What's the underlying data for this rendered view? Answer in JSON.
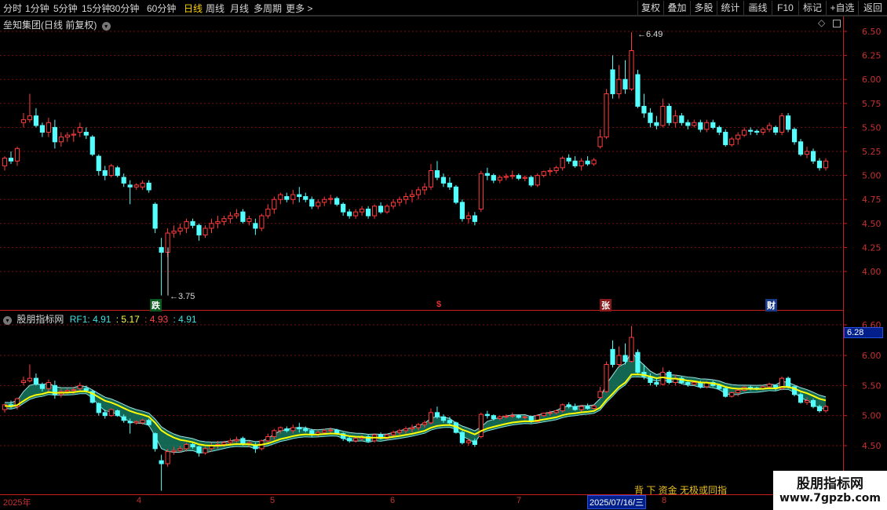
{
  "toolbar": {
    "periods": [
      "分时",
      "1分钟",
      "5分钟",
      "15分钟",
      "30分钟",
      "60分钟",
      "日线",
      "周线",
      "月线",
      "多周期",
      "更多 >"
    ],
    "active_period": "日线",
    "buttons": [
      "复权",
      "叠加",
      "多股",
      "统计",
      "画线",
      "F10",
      "标记",
      "+自选",
      "返回"
    ]
  },
  "main_panel": {
    "title": "垒知集团(日线 前复权)",
    "high_marker": "6.49",
    "low_marker": "3.75",
    "price_axis": [
      "6.50",
      "6.25",
      "6.00",
      "5.75",
      "5.50",
      "5.25",
      "5.00",
      "4.75",
      "4.50",
      "4.25",
      "4.00"
    ],
    "signals": [
      {
        "label": "跌",
        "color": "#ffffff",
        "bg": "#0a5a1e"
      },
      {
        "label": "$",
        "color": "#e03030",
        "bg": ""
      },
      {
        "label": "张",
        "color": "#ffffff",
        "bg": "#8a1a1a"
      },
      {
        "label": "财",
        "color": "#ffffff",
        "bg": "#1a3a8a"
      }
    ]
  },
  "indicator_panel": {
    "name": "股朋指标网",
    "rf1_label": "RF1:",
    "values": [
      "4.91",
      ": 5.17",
      ": 4.93",
      ": 4.91"
    ],
    "value_colors": [
      "#40e0e0",
      "#ffff40",
      "#ff4040",
      "#40e0e0"
    ],
    "axis": [
      "6.60",
      "6.00",
      "5.50",
      "5.00",
      "4.50"
    ],
    "current_box": "6.28",
    "bottom_text": "背 下 资金 无极或同指"
  },
  "time_axis": {
    "labels": [
      "2025年",
      "4",
      "5",
      "6",
      "7",
      "8"
    ],
    "cursor_date": "2025/07/16/三"
  },
  "watermark": {
    "title": "股朋指标网",
    "url": "www.7gpzb.com"
  },
  "colors": {
    "up": "#ff3c3c",
    "down": "#54ffff",
    "grid": "#7a1010",
    "ma": "#ffff00",
    "band_fill": "#1a8a6e"
  },
  "chart_data": {
    "type": "candlestick",
    "ylim": [
      3.7,
      6.6
    ],
    "candles": [
      [
        5.1,
        5.2,
        5.05,
        5.18
      ],
      [
        5.18,
        5.25,
        5.12,
        5.15
      ],
      [
        5.15,
        5.3,
        5.1,
        5.28
      ],
      [
        5.55,
        5.65,
        5.5,
        5.58
      ],
      [
        5.58,
        5.85,
        5.55,
        5.62
      ],
      [
        5.62,
        5.7,
        5.5,
        5.52
      ],
      [
        5.52,
        5.55,
        5.4,
        5.45
      ],
      [
        5.45,
        5.6,
        5.4,
        5.55
      ],
      [
        5.5,
        5.58,
        5.28,
        5.35
      ],
      [
        5.35,
        5.45,
        5.3,
        5.4
      ],
      [
        5.4,
        5.45,
        5.35,
        5.42
      ],
      [
        5.42,
        5.48,
        5.35,
        5.43
      ],
      [
        5.45,
        5.55,
        5.4,
        5.5
      ],
      [
        5.45,
        5.5,
        5.38,
        5.42
      ],
      [
        5.4,
        5.42,
        5.2,
        5.22
      ],
      [
        5.2,
        5.22,
        5.0,
        5.05
      ],
      [
        5.05,
        5.1,
        4.95,
        5.0
      ],
      [
        5.0,
        5.12,
        4.98,
        5.1
      ],
      [
        5.08,
        5.1,
        4.98,
        5.0
      ],
      [
        4.98,
        5.02,
        4.88,
        4.92
      ],
      [
        4.9,
        4.95,
        4.7,
        4.88
      ],
      [
        4.88,
        4.92,
        4.85,
        4.9
      ],
      [
        4.88,
        4.95,
        4.85,
        4.92
      ],
      [
        4.92,
        4.95,
        4.82,
        4.85
      ],
      [
        4.7,
        4.72,
        4.4,
        4.45
      ],
      [
        4.25,
        4.35,
        3.75,
        4.2
      ],
      [
        4.2,
        4.45,
        4.15,
        4.4
      ],
      [
        4.4,
        4.48,
        4.35,
        4.42
      ],
      [
        4.42,
        4.5,
        4.38,
        4.45
      ],
      [
        4.45,
        4.55,
        4.4,
        4.52
      ],
      [
        4.52,
        4.55,
        4.45,
        4.48
      ],
      [
        4.48,
        4.5,
        4.32,
        4.38
      ],
      [
        4.38,
        4.48,
        4.35,
        4.45
      ],
      [
        4.45,
        4.55,
        4.4,
        4.5
      ],
      [
        4.5,
        4.58,
        4.45,
        4.52
      ],
      [
        4.52,
        4.58,
        4.48,
        4.55
      ],
      [
        4.55,
        4.62,
        4.5,
        4.58
      ],
      [
        4.58,
        4.65,
        4.55,
        4.6
      ],
      [
        4.62,
        4.65,
        4.5,
        4.52
      ],
      [
        4.52,
        4.58,
        4.48,
        4.55
      ],
      [
        4.5,
        4.55,
        4.38,
        4.45
      ],
      [
        4.45,
        4.6,
        4.42,
        4.58
      ],
      [
        4.58,
        4.7,
        4.55,
        4.65
      ],
      [
        4.65,
        4.78,
        4.6,
        4.75
      ],
      [
        4.75,
        4.82,
        4.7,
        4.8
      ],
      [
        4.78,
        4.82,
        4.72,
        4.75
      ],
      [
        4.75,
        4.85,
        4.7,
        4.8
      ],
      [
        4.8,
        4.88,
        4.72,
        4.78
      ],
      [
        4.78,
        4.82,
        4.72,
        4.75
      ],
      [
        4.75,
        4.78,
        4.65,
        4.68
      ],
      [
        4.68,
        4.75,
        4.65,
        4.72
      ],
      [
        4.72,
        4.78,
        4.68,
        4.75
      ],
      [
        4.75,
        4.8,
        4.7,
        4.76
      ],
      [
        4.76,
        4.78,
        4.68,
        4.7
      ],
      [
        4.7,
        4.72,
        4.58,
        4.62
      ],
      [
        4.62,
        4.65,
        4.55,
        4.58
      ],
      [
        4.58,
        4.65,
        4.55,
        4.62
      ],
      [
        4.62,
        4.68,
        4.58,
        4.65
      ],
      [
        4.65,
        4.68,
        4.55,
        4.58
      ],
      [
        4.58,
        4.7,
        4.55,
        4.68
      ],
      [
        4.68,
        4.72,
        4.6,
        4.62
      ],
      [
        4.62,
        4.7,
        4.6,
        4.68
      ],
      [
        4.68,
        4.75,
        4.65,
        4.72
      ],
      [
        4.72,
        4.78,
        4.68,
        4.75
      ],
      [
        4.75,
        4.82,
        4.7,
        4.78
      ],
      [
        4.78,
        4.85,
        4.72,
        4.8
      ],
      [
        4.8,
        4.88,
        4.75,
        4.85
      ],
      [
        4.85,
        4.92,
        4.8,
        4.88
      ],
      [
        4.88,
        5.12,
        4.85,
        5.05
      ],
      [
        5.05,
        5.15,
        4.95,
        4.98
      ],
      [
        4.98,
        5.02,
        4.88,
        4.92
      ],
      [
        4.92,
        4.98,
        4.85,
        4.88
      ],
      [
        4.88,
        4.9,
        4.7,
        4.72
      ],
      [
        4.72,
        4.75,
        4.52,
        4.55
      ],
      [
        4.55,
        4.62,
        4.5,
        4.58
      ],
      [
        4.58,
        4.62,
        4.48,
        4.52
      ],
      [
        4.65,
        5.05,
        4.62,
        5.02
      ],
      [
        5.02,
        5.08,
        4.95,
        5.0
      ],
      [
        5.0,
        5.02,
        4.92,
        4.95
      ],
      [
        4.95,
        5.0,
        4.92,
        4.98
      ],
      [
        4.98,
        5.02,
        4.95,
        4.99
      ],
      [
        4.99,
        5.05,
        4.96,
        5.0
      ],
      [
        5.0,
        5.02,
        4.95,
        4.97
      ],
      [
        4.97,
        5.0,
        4.94,
        4.98
      ],
      [
        4.98,
        5.0,
        4.88,
        4.9
      ],
      [
        4.9,
        5.02,
        4.88,
        5.0
      ],
      [
        5.0,
        5.05,
        4.98,
        5.04
      ],
      [
        5.04,
        5.08,
        5.0,
        5.05
      ],
      [
        5.05,
        5.1,
        5.02,
        5.08
      ],
      [
        5.08,
        5.2,
        5.05,
        5.18
      ],
      [
        5.18,
        5.22,
        5.12,
        5.15
      ],
      [
        5.15,
        5.2,
        5.08,
        5.1
      ],
      [
        5.1,
        5.18,
        5.05,
        5.15
      ],
      [
        5.15,
        5.2,
        5.1,
        5.12
      ],
      [
        5.12,
        5.18,
        5.1,
        5.16
      ],
      [
        5.3,
        5.48,
        5.28,
        5.4
      ],
      [
        5.4,
        5.9,
        5.38,
        5.85
      ],
      [
        6.1,
        6.25,
        5.8,
        5.85
      ],
      [
        5.85,
        6.15,
        5.8,
        6.0
      ],
      [
        6.0,
        6.2,
        5.85,
        5.9
      ],
      [
        5.9,
        6.49,
        5.88,
        6.3
      ],
      [
        6.05,
        6.1,
        5.7,
        5.72
      ],
      [
        5.72,
        5.85,
        5.6,
        5.65
      ],
      [
        5.65,
        5.7,
        5.5,
        5.55
      ],
      [
        5.55,
        5.62,
        5.48,
        5.52
      ],
      [
        5.52,
        5.8,
        5.5,
        5.72
      ],
      [
        5.72,
        5.75,
        5.52,
        5.55
      ],
      [
        5.55,
        5.68,
        5.5,
        5.62
      ],
      [
        5.62,
        5.65,
        5.52,
        5.55
      ],
      [
        5.55,
        5.58,
        5.48,
        5.52
      ],
      [
        5.52,
        5.58,
        5.5,
        5.55
      ],
      [
        5.55,
        5.58,
        5.45,
        5.48
      ],
      [
        5.48,
        5.58,
        5.45,
        5.55
      ],
      [
        5.55,
        5.58,
        5.48,
        5.5
      ],
      [
        5.5,
        5.52,
        5.42,
        5.45
      ],
      [
        5.45,
        5.48,
        5.3,
        5.32
      ],
      [
        5.32,
        5.4,
        5.3,
        5.38
      ],
      [
        5.38,
        5.45,
        5.32,
        5.42
      ],
      [
        5.42,
        5.5,
        5.4,
        5.47
      ],
      [
        5.47,
        5.5,
        5.42,
        5.46
      ],
      [
        5.46,
        5.48,
        5.42,
        5.45
      ],
      [
        5.45,
        5.5,
        5.42,
        5.48
      ],
      [
        5.48,
        5.55,
        5.45,
        5.52
      ],
      [
        5.5,
        5.52,
        5.42,
        5.45
      ],
      [
        5.45,
        5.65,
        5.42,
        5.62
      ],
      [
        5.62,
        5.65,
        5.45,
        5.48
      ],
      [
        5.48,
        5.5,
        5.32,
        5.35
      ],
      [
        5.35,
        5.38,
        5.2,
        5.22
      ],
      [
        5.22,
        5.3,
        5.18,
        5.25
      ],
      [
        5.25,
        5.28,
        5.12,
        5.15
      ],
      [
        5.15,
        5.18,
        5.05,
        5.08
      ],
      [
        5.08,
        5.18,
        5.05,
        5.15
      ]
    ]
  }
}
